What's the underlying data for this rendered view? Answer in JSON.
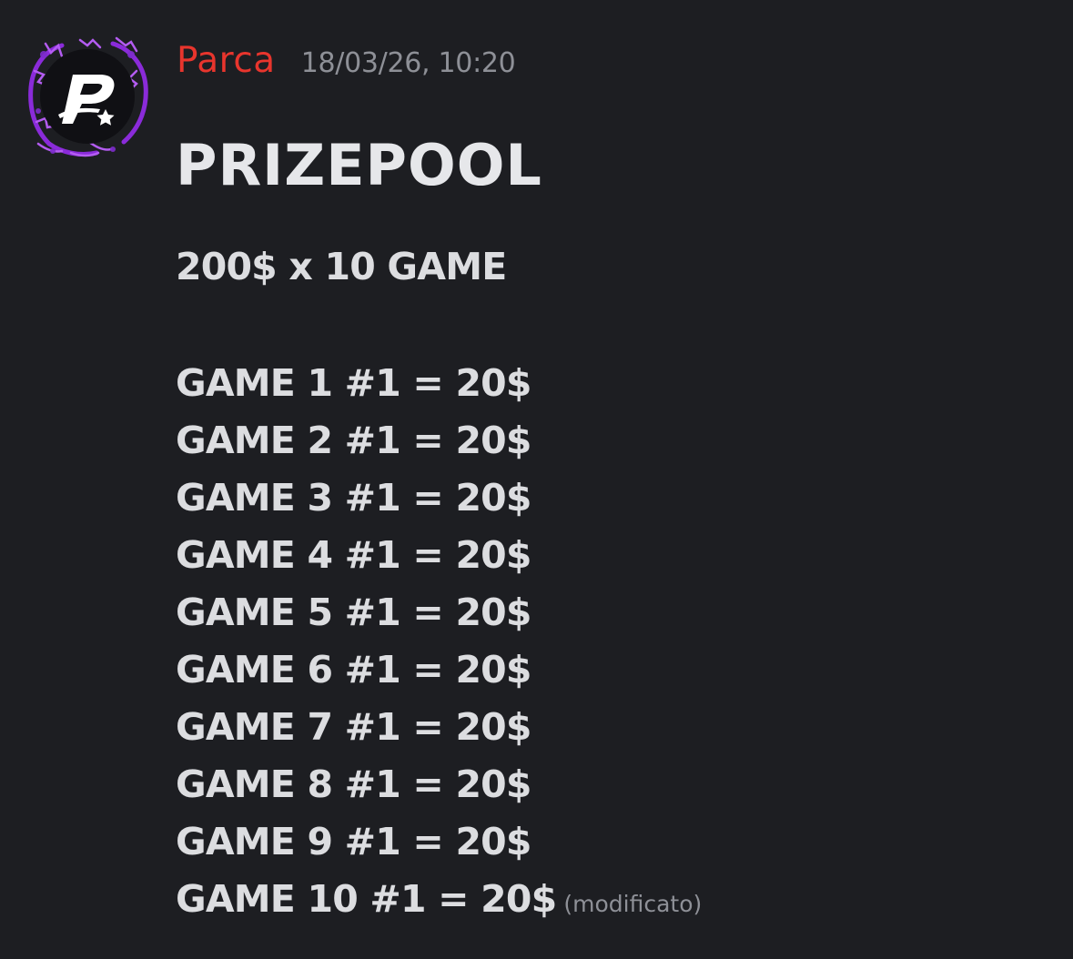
{
  "message": {
    "username": "Parca",
    "timestamp": "18/03/26, 10:20",
    "username_color": "#e8352d",
    "avatar_icon": "purple-dragon-p-logo",
    "title": "PRIZEPOOL",
    "subtitle": "200$ x 10 GAME",
    "lines": [
      "GAME 1 #1 = 20$",
      "GAME 2 #1 = 20$",
      "GAME 3 #1 = 20$",
      "GAME 4 #1 = 20$",
      "GAME 5 #1 = 20$",
      "GAME 6 #1 = 20$",
      "GAME 7 #1 = 20$",
      "GAME 8 #1 = 20$",
      "GAME 9 #1 = 20$",
      "GAME 10 #1 = 20$"
    ],
    "edited_label": "(modificato)"
  }
}
